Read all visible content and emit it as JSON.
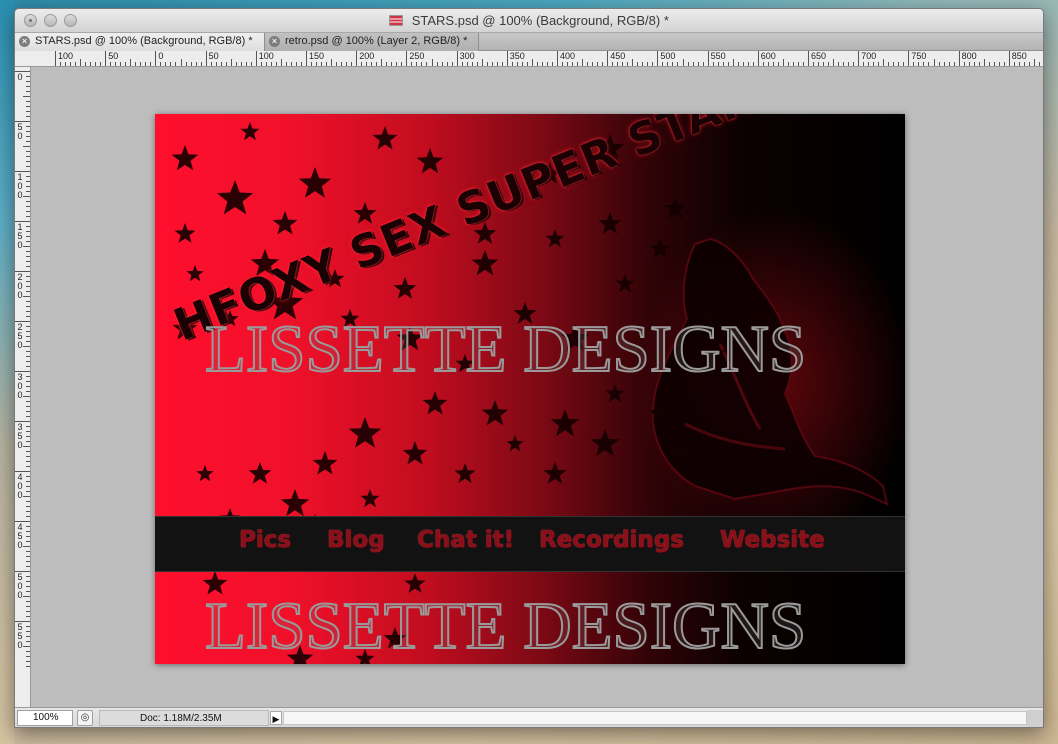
{
  "window": {
    "title": "STARS.psd @ 100% (Background, RGB/8) *"
  },
  "tabs": [
    {
      "label": "STARS.psd @ 100% (Background, RGB/8) *",
      "active": true
    },
    {
      "label": "retro.psd @ 100% (Layer 2, RGB/8) *",
      "active": false
    }
  ],
  "ruler": {
    "horizontal_labels": [
      "100",
      "50",
      "0",
      "50",
      "100",
      "150",
      "200",
      "250",
      "300",
      "350",
      "400",
      "450",
      "500",
      "550",
      "600",
      "650",
      "700",
      "750",
      "800",
      "850"
    ],
    "vertical_labels": [
      "0",
      "5 0",
      "1 0 0",
      "1 5 0",
      "2 0 0",
      "2 5 0",
      "3 0 0",
      "3 5 0",
      "4 0 0",
      "4 5 0",
      "5 0 0",
      "5 5 0"
    ]
  },
  "artwork": {
    "headline": "HFOXY SEX SUPER STAR",
    "watermark_top": "LISSETTE DESIGNS",
    "watermark_bottom": "LISSETTE DESIGNS",
    "nav": [
      "Pics",
      "Blog",
      "Chat it!",
      "Recordings",
      "Website"
    ]
  },
  "status": {
    "zoom": "100%",
    "doc_info": "Doc: 1.18M/2.35M"
  },
  "colors": {
    "accent_red": "#ff0f2d",
    "nav_text": "#8a0f18"
  }
}
